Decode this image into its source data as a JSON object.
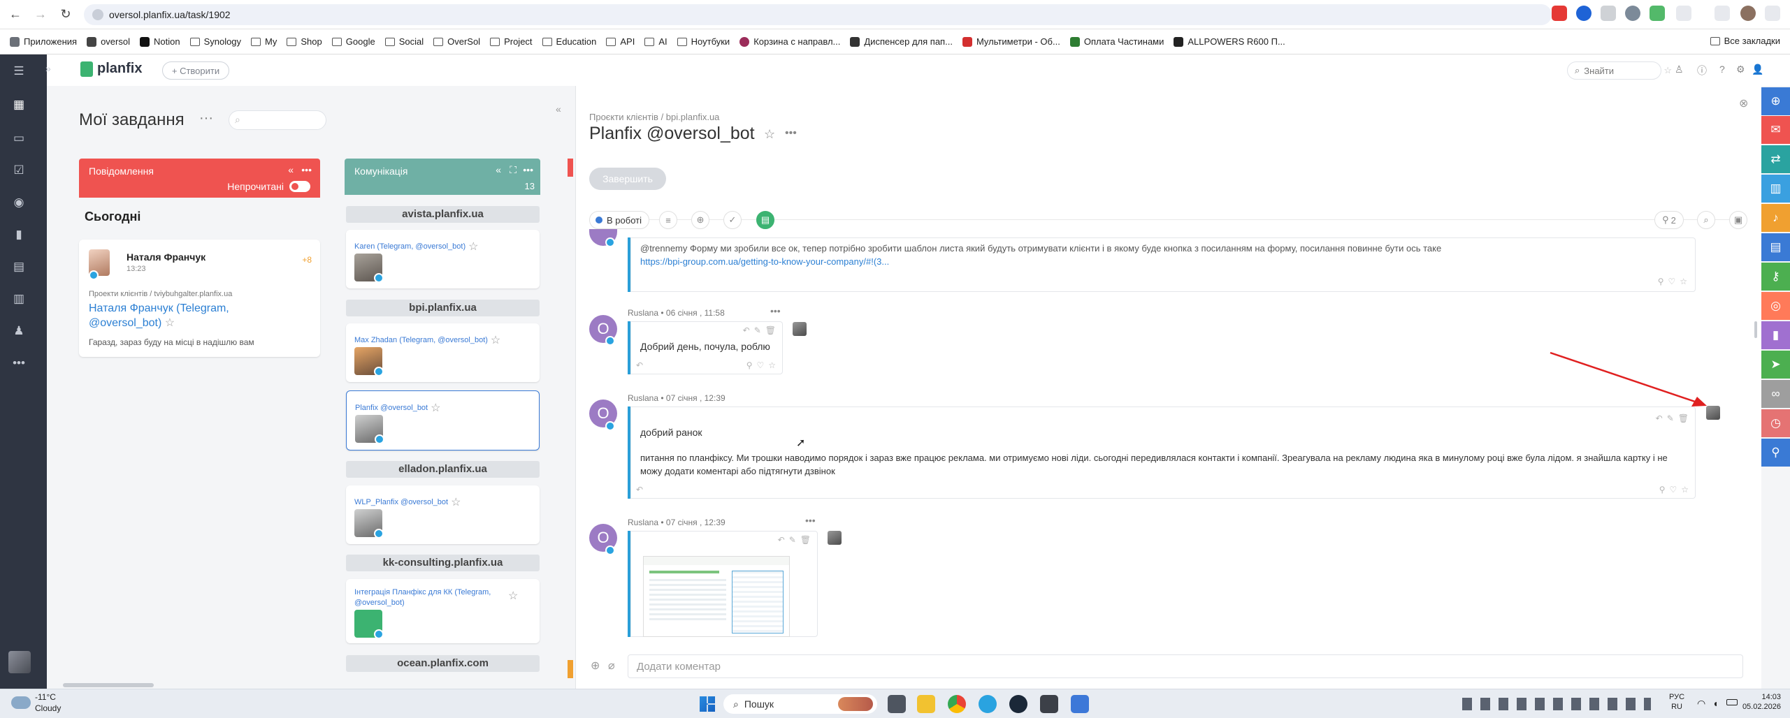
{
  "browser": {
    "url": "oversol.planfix.ua/task/1902",
    "bookmarks": [
      "Приложения",
      "oversol",
      "Notion",
      "Synology",
      "My",
      "Shop",
      "Google",
      "Social",
      "OverSol",
      "Project",
      "Education",
      "API",
      "AI",
      "Ноутбуки",
      "Корзина с направл...",
      "Диспенсер для пап...",
      "Мультиметри - Об...",
      "Оплата Частинами",
      "ALLPOWERS R600 П..."
    ],
    "all_bookmarks": "Все закладки"
  },
  "app": {
    "logo": "planfix",
    "create_label": "+ Створити",
    "search_placeholder": "Знайти"
  },
  "tasks": {
    "title": "Мої завдання",
    "dots": "···",
    "columns": {
      "notifications": {
        "title": "Повідомлення",
        "unread_label": "Непрочитані",
        "color": "#ef5350"
      },
      "communication": {
        "title": "Комунікація",
        "count": "13",
        "color": "#6fb0a5"
      }
    },
    "today_label": "Сьогодні",
    "notif_card": {
      "name": "Наталя Франчук",
      "time": "13:23",
      "badge": "+8",
      "path": "Проекти клієнтів / tviybuhgalter.planfix.ua",
      "link": "Наталя Франчук (Telegram, @oversol_bot)",
      "text": "Гаразд, зараз буду на місці в надішлю вам"
    },
    "sections": [
      {
        "header": "avista.planfix.ua",
        "card": "Karen (Telegram, @oversol_bot)"
      },
      {
        "header": "bpi.planfix.ua",
        "card": "Max Zhadan (Telegram, @oversol_bot)",
        "card2": "Planfix @oversol_bot"
      },
      {
        "header": "elladon.planfix.ua",
        "card": "WLP_Planfix @oversol_bot"
      },
      {
        "header": "kk-consulting.planfix.ua",
        "card": "Інтеграція Планфікс для КК (Telegram, @oversol_bot)"
      },
      {
        "header": "ocean.planfix.com"
      }
    ]
  },
  "task": {
    "breadcrumb": "Проєкти клієнтів / bpi.planfix.ua",
    "title": "Planfix @oversol_bot",
    "finish_label": "Завершить",
    "status": "В роботі",
    "pins": "2",
    "comment_placeholder": "Додати коментар"
  },
  "messages": [
    {
      "text": "@trennemy Форму ми зробили все ок, тепер потрібно зробити шаблон листа який будуть отримувати клієнти і в якому буде кнопка з посиланням на форму, посилання повинне бути ось таке",
      "link": "https://bpi-group.com.ua/getting-to-know-your-company/#!(3..."
    },
    {
      "author": "Ruslana",
      "date": "06 січня , 11:58",
      "text": "Добрий день, почула, роблю"
    },
    {
      "author": "Ruslana",
      "date": "07 січня , 12:39",
      "text": "добрий ранок",
      "text2": "питання по планфіксу. Ми трошки наводимо порядок і зараз вже працює реклама. ми отримуємо нові ліди. сьогодні передивлялася контакти і компанії. Зреагувала на рекламу людина яка в минулому році вже була лідом. я знайшла картку і не можу додати коментарі або підтягнути дзвінок"
    },
    {
      "author": "Ruslana",
      "date": "07 січня , 12:39"
    }
  ],
  "avatar_letter": "O",
  "taskbar": {
    "weather_temp": "-11°C",
    "weather_text": "Cloudy",
    "search": "Пошук",
    "lang1": "РУС",
    "lang2": "RU",
    "time": "14:03",
    "date": "05.02.2026"
  },
  "colors": {
    "accent": "#2a9fd8",
    "sidebar": "#2f3542",
    "strip": [
      "#3a7ad5",
      "#ef5350",
      "#2aa3a0",
      "#3aa0e0",
      "#f0a030",
      "#3a7ad5",
      "#4caf50",
      "#ff7a59",
      "#a070d0",
      "#4caf50",
      "#9e9e9e",
      "#e57373",
      "#3a7ad5"
    ]
  }
}
